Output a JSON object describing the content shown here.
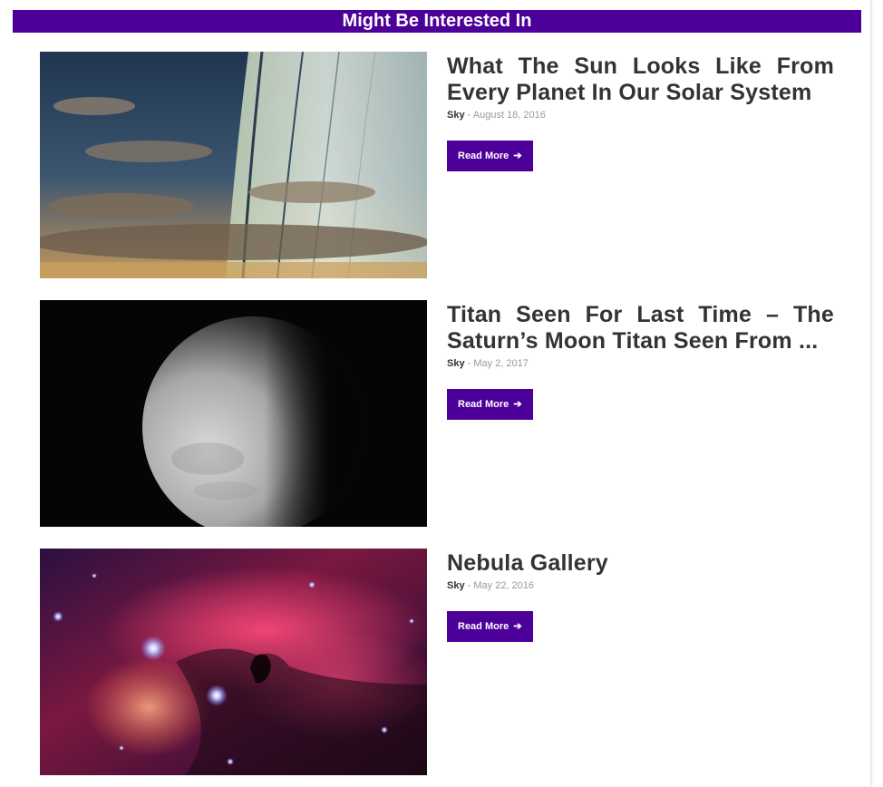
{
  "section": {
    "heading": "Might Be Interested In"
  },
  "posts": [
    {
      "title": "What The Sun Looks Like From Every Planet In Our Solar System",
      "author": "Sky",
      "separator": " - ",
      "date": "August 18, 2016",
      "read_more": "Read More",
      "thumbnail": "saturn-rings-sky-image"
    },
    {
      "title": "Titan Seen For Last Time – The Saturn’s Moon Titan Seen From ...",
      "author": "Sky",
      "separator": " - ",
      "date": "May 2, 2017",
      "read_more": "Read More",
      "thumbnail": "titan-moon-image"
    },
    {
      "title": "Nebula Gallery",
      "author": "Sky",
      "separator": " - ",
      "date": "May 22, 2016",
      "read_more": "Read More",
      "thumbnail": "horsehead-nebula-image"
    }
  ],
  "icons": {
    "read_more_arrow": "arrow-right-icon"
  },
  "colors": {
    "accent": "#4d0099",
    "title": "#333333",
    "meta": "#999999"
  }
}
